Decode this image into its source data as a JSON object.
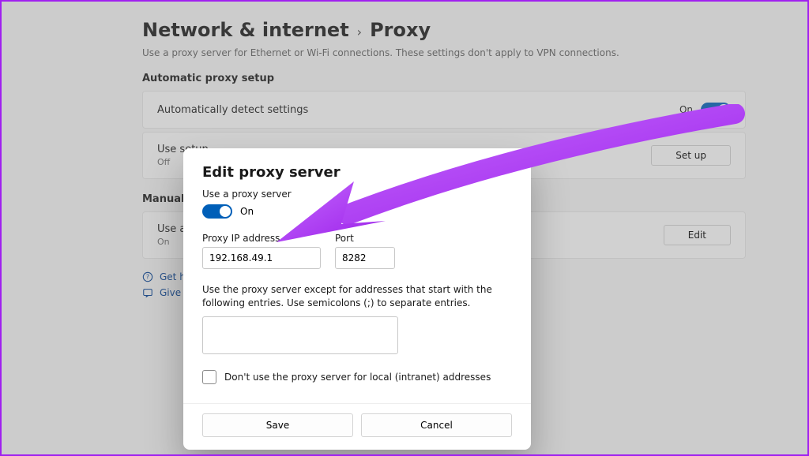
{
  "breadcrumb": {
    "parent": "Network & internet",
    "current": "Proxy"
  },
  "page_description": "Use a proxy server for Ethernet or Wi-Fi connections. These settings don't apply to VPN connections.",
  "sections": {
    "automatic": {
      "title": "Automatic proxy setup",
      "detect": {
        "label": "Automatically detect settings",
        "state_text": "On"
      },
      "script": {
        "label": "Use setup",
        "sub": "Off",
        "button": "Set up"
      }
    },
    "manual": {
      "title": "Manual proxy",
      "proxy": {
        "label": "Use a proxy",
        "sub": "On",
        "button": "Edit"
      }
    }
  },
  "help": {
    "get_help": "Get help",
    "feedback": "Give fee"
  },
  "modal": {
    "title": "Edit proxy server",
    "use_proxy_label": "Use a proxy server",
    "toggle_state_text": "On",
    "ip_label": "Proxy IP address",
    "ip_value": "192.168.49.1",
    "port_label": "Port",
    "port_value": "8282",
    "exceptions_text": "Use the proxy server except for addresses that start with the following entries. Use semicolons (;) to separate entries.",
    "exceptions_value": "",
    "local_bypass_label": "Don't use the proxy server for local (intranet) addresses",
    "save": "Save",
    "cancel": "Cancel"
  },
  "colors": {
    "accent": "#005fb8",
    "annotation": "#a020f0"
  }
}
